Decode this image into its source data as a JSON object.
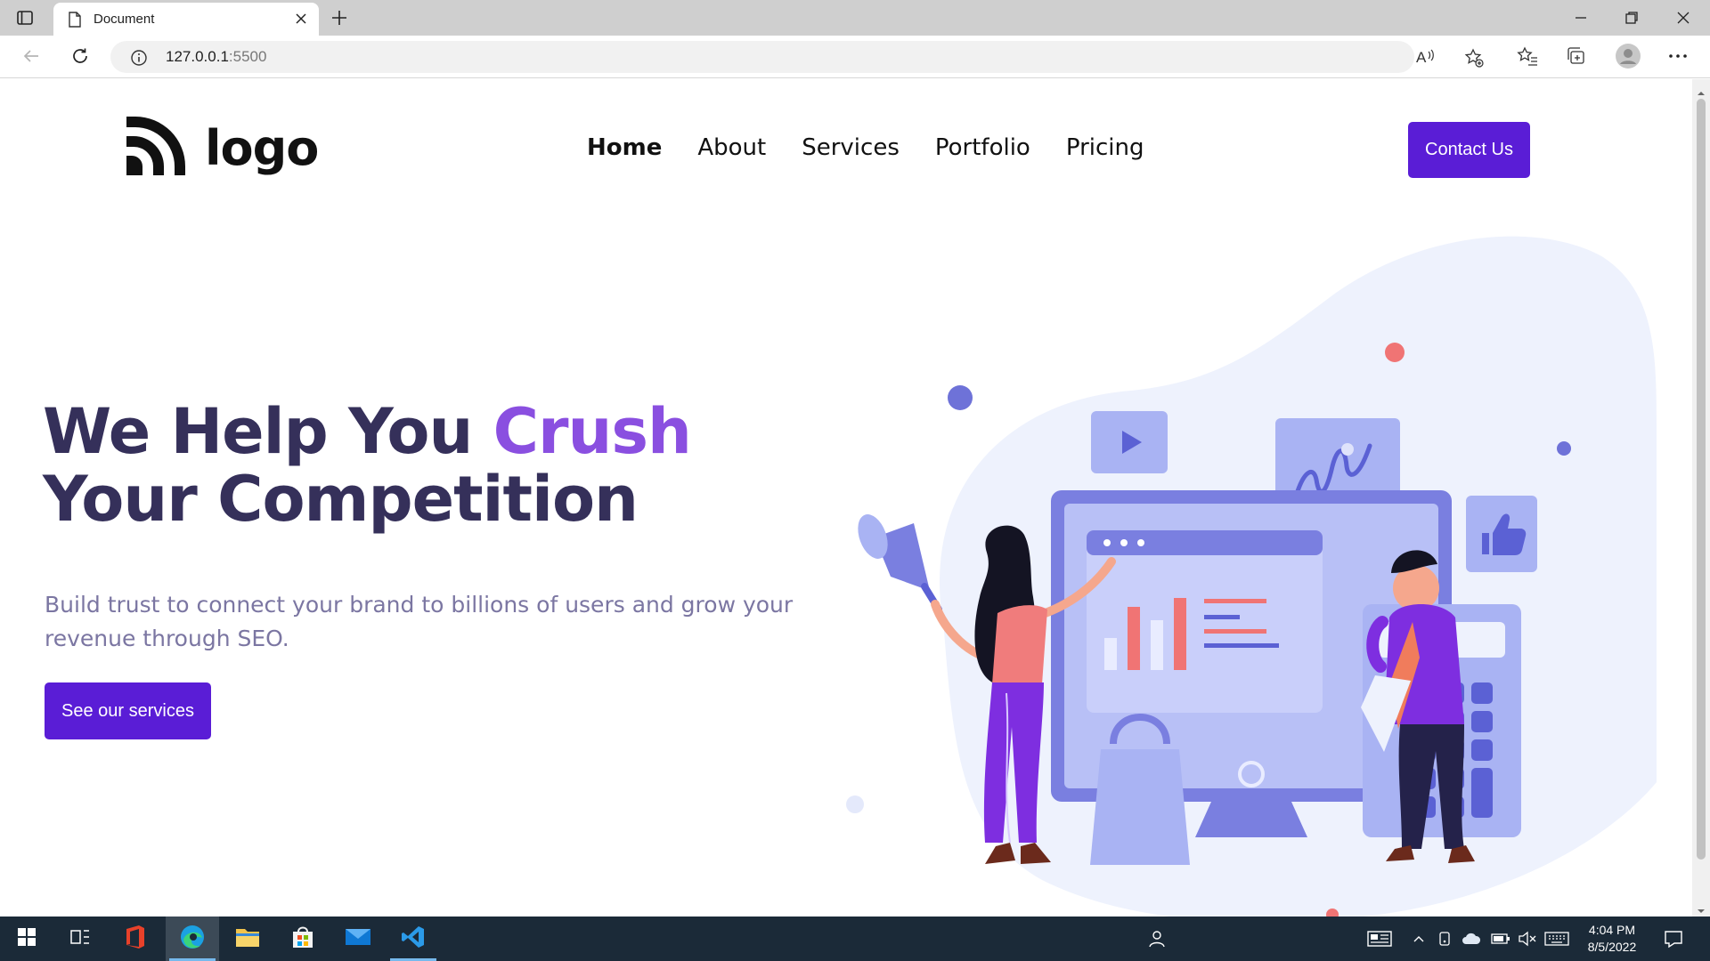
{
  "browser": {
    "tab_title": "Document",
    "url_host": "127.0.0.1",
    "url_port": ":5500"
  },
  "site": {
    "logo_text": "logo",
    "nav": [
      {
        "label": "Home",
        "active": true
      },
      {
        "label": "About"
      },
      {
        "label": "Services"
      },
      {
        "label": "Portfolio"
      },
      {
        "label": "Pricing"
      }
    ],
    "contact_label": "Contact Us",
    "hero": {
      "title_part1": "We Help You ",
      "title_accent": "Crush",
      "title_line2": "Your Competition",
      "subtitle": "Build trust to connect your brand to billions of users and grow your revenue through SEO.",
      "cta_label": "See our services"
    }
  },
  "taskbar": {
    "time": "4:04 PM",
    "date": "8/5/2022"
  },
  "colors": {
    "brand": "#5a1dd6",
    "heading": "#35305a",
    "accent": "#8a4fe0",
    "subtext": "#7b76a2"
  }
}
